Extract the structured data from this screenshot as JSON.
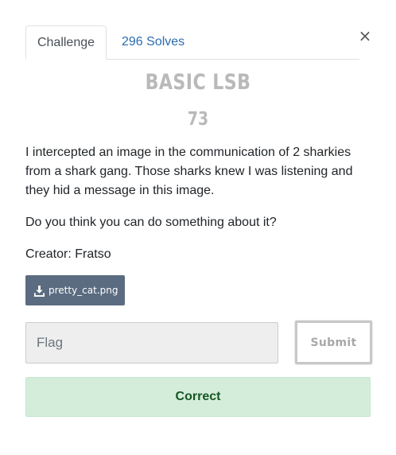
{
  "modal": {
    "close_label": "×",
    "tabs": [
      {
        "label": "Challenge",
        "active": true
      },
      {
        "label": "296 Solves",
        "active": false
      }
    ],
    "challenge": {
      "name": "BASIC LSB",
      "value": "73",
      "description": [
        "I intercepted an image in the communication of 2 sharkies from a shark gang. Those sharks knew I was listening and they hid a message in this image.",
        "Do you think you can do something about it?",
        "Creator: Fratso"
      ],
      "file": {
        "label": "pretty_cat.png",
        "icon": "download-icon"
      }
    },
    "flag_input": {
      "placeholder": "Flag",
      "value": ""
    },
    "submit_label": "Submit",
    "result_message": "Correct"
  },
  "colors": {
    "tab_link": "#2b6cb0",
    "title_gray": "#b9b9b9",
    "file_button_bg": "#5b6b80",
    "flag_input_bg": "#eeeeee",
    "success_bg": "#d4edda",
    "success_text": "#155724"
  }
}
